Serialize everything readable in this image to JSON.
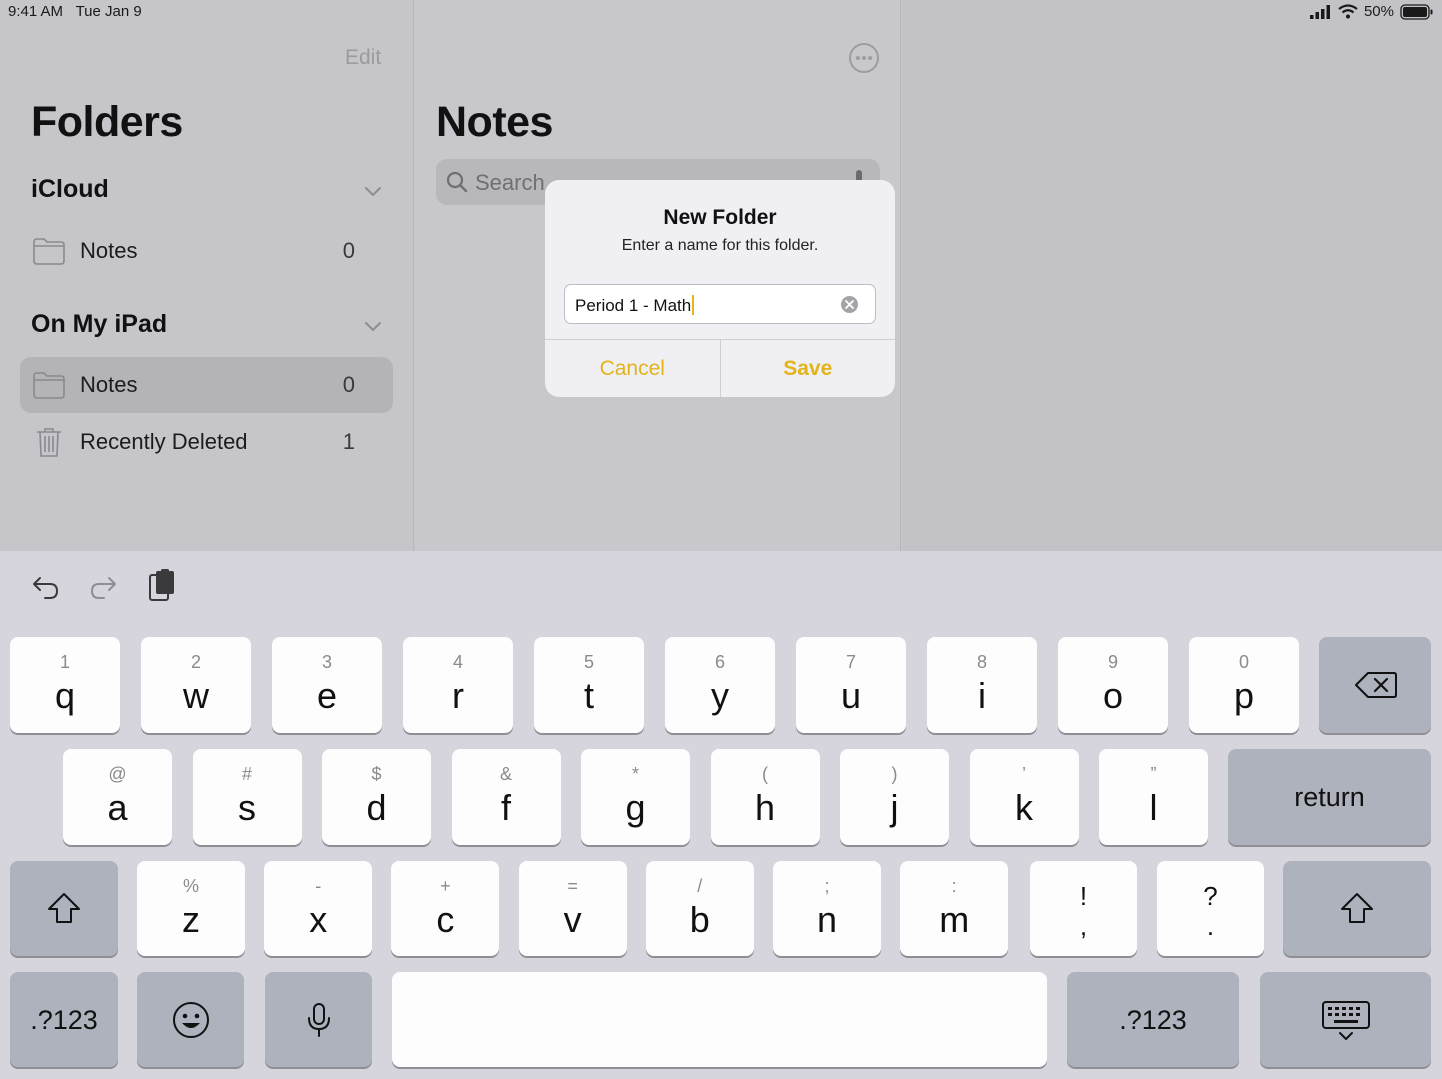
{
  "status": {
    "time": "9:41 AM",
    "date": "Tue Jan 9",
    "battery": "50%"
  },
  "sidebar": {
    "edit_label": "Edit",
    "title": "Folders",
    "sections": [
      {
        "title": "iCloud",
        "items": [
          {
            "label": "Notes",
            "count": "0"
          }
        ]
      },
      {
        "title": "On My iPad",
        "items": [
          {
            "label": "Notes",
            "count": "0"
          },
          {
            "label": "Recently Deleted",
            "count": "1"
          }
        ]
      }
    ]
  },
  "list": {
    "title": "Notes",
    "search_placeholder": "Search"
  },
  "alert": {
    "title": "New Folder",
    "message": "Enter a name for this folder.",
    "field_value": "Period 1 - Math",
    "cancel_label": "Cancel",
    "save_label": "Save"
  },
  "colors": {
    "accent": "#e2b41a",
    "selected_row": "#b4b3b8"
  },
  "keyboard": {
    "row1": [
      {
        "hint": "1",
        "key": "q"
      },
      {
        "hint": "2",
        "key": "w"
      },
      {
        "hint": "3",
        "key": "e"
      },
      {
        "hint": "4",
        "key": "r"
      },
      {
        "hint": "5",
        "key": "t"
      },
      {
        "hint": "6",
        "key": "y"
      },
      {
        "hint": "7",
        "key": "u"
      },
      {
        "hint": "8",
        "key": "i"
      },
      {
        "hint": "9",
        "key": "o"
      },
      {
        "hint": "0",
        "key": "p"
      }
    ],
    "row2": [
      {
        "hint": "@",
        "key": "a"
      },
      {
        "hint": "#",
        "key": "s"
      },
      {
        "hint": "$",
        "key": "d"
      },
      {
        "hint": "&",
        "key": "f"
      },
      {
        "hint": "*",
        "key": "g"
      },
      {
        "hint": "(",
        "key": "h"
      },
      {
        "hint": ")",
        "key": "j"
      },
      {
        "hint": "’",
        "key": "k"
      },
      {
        "hint": "”",
        "key": "l"
      }
    ],
    "row3": [
      {
        "hint": "%",
        "key": "z"
      },
      {
        "hint": "-",
        "key": "x"
      },
      {
        "hint": "+",
        "key": "c"
      },
      {
        "hint": "=",
        "key": "v"
      },
      {
        "hint": "/",
        "key": "b"
      },
      {
        "hint": ";",
        "key": "n"
      },
      {
        "hint": ":",
        "key": "m"
      }
    ],
    "punct": [
      {
        "top": "!",
        "bottom": ","
      },
      {
        "top": "?",
        "bottom": "."
      }
    ],
    "return_label": "return",
    "numbers_label": ".?123"
  }
}
